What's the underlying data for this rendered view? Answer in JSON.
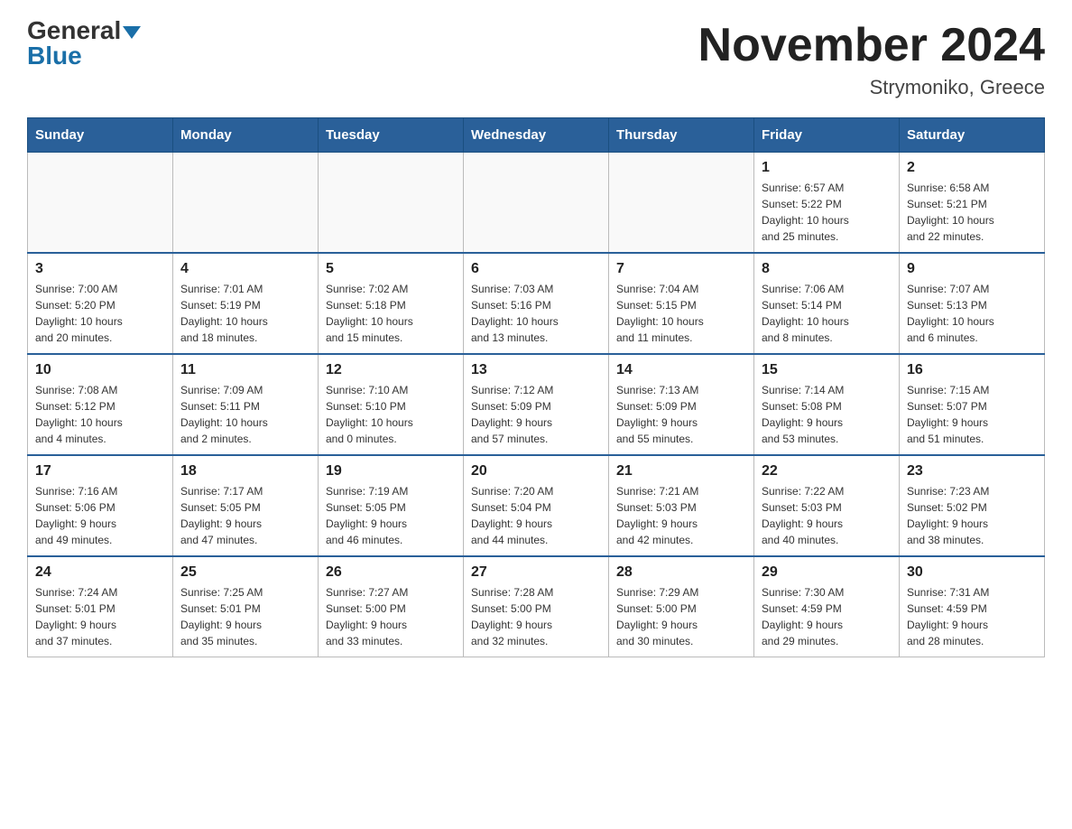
{
  "header": {
    "logo_general": "General",
    "logo_blue": "Blue",
    "title": "November 2024",
    "subtitle": "Strymoniko, Greece"
  },
  "weekdays": [
    "Sunday",
    "Monday",
    "Tuesday",
    "Wednesday",
    "Thursday",
    "Friday",
    "Saturday"
  ],
  "weeks": [
    [
      {
        "day": "",
        "info": ""
      },
      {
        "day": "",
        "info": ""
      },
      {
        "day": "",
        "info": ""
      },
      {
        "day": "",
        "info": ""
      },
      {
        "day": "",
        "info": ""
      },
      {
        "day": "1",
        "info": "Sunrise: 6:57 AM\nSunset: 5:22 PM\nDaylight: 10 hours\nand 25 minutes."
      },
      {
        "day": "2",
        "info": "Sunrise: 6:58 AM\nSunset: 5:21 PM\nDaylight: 10 hours\nand 22 minutes."
      }
    ],
    [
      {
        "day": "3",
        "info": "Sunrise: 7:00 AM\nSunset: 5:20 PM\nDaylight: 10 hours\nand 20 minutes."
      },
      {
        "day": "4",
        "info": "Sunrise: 7:01 AM\nSunset: 5:19 PM\nDaylight: 10 hours\nand 18 minutes."
      },
      {
        "day": "5",
        "info": "Sunrise: 7:02 AM\nSunset: 5:18 PM\nDaylight: 10 hours\nand 15 minutes."
      },
      {
        "day": "6",
        "info": "Sunrise: 7:03 AM\nSunset: 5:16 PM\nDaylight: 10 hours\nand 13 minutes."
      },
      {
        "day": "7",
        "info": "Sunrise: 7:04 AM\nSunset: 5:15 PM\nDaylight: 10 hours\nand 11 minutes."
      },
      {
        "day": "8",
        "info": "Sunrise: 7:06 AM\nSunset: 5:14 PM\nDaylight: 10 hours\nand 8 minutes."
      },
      {
        "day": "9",
        "info": "Sunrise: 7:07 AM\nSunset: 5:13 PM\nDaylight: 10 hours\nand 6 minutes."
      }
    ],
    [
      {
        "day": "10",
        "info": "Sunrise: 7:08 AM\nSunset: 5:12 PM\nDaylight: 10 hours\nand 4 minutes."
      },
      {
        "day": "11",
        "info": "Sunrise: 7:09 AM\nSunset: 5:11 PM\nDaylight: 10 hours\nand 2 minutes."
      },
      {
        "day": "12",
        "info": "Sunrise: 7:10 AM\nSunset: 5:10 PM\nDaylight: 10 hours\nand 0 minutes."
      },
      {
        "day": "13",
        "info": "Sunrise: 7:12 AM\nSunset: 5:09 PM\nDaylight: 9 hours\nand 57 minutes."
      },
      {
        "day": "14",
        "info": "Sunrise: 7:13 AM\nSunset: 5:09 PM\nDaylight: 9 hours\nand 55 minutes."
      },
      {
        "day": "15",
        "info": "Sunrise: 7:14 AM\nSunset: 5:08 PM\nDaylight: 9 hours\nand 53 minutes."
      },
      {
        "day": "16",
        "info": "Sunrise: 7:15 AM\nSunset: 5:07 PM\nDaylight: 9 hours\nand 51 minutes."
      }
    ],
    [
      {
        "day": "17",
        "info": "Sunrise: 7:16 AM\nSunset: 5:06 PM\nDaylight: 9 hours\nand 49 minutes."
      },
      {
        "day": "18",
        "info": "Sunrise: 7:17 AM\nSunset: 5:05 PM\nDaylight: 9 hours\nand 47 minutes."
      },
      {
        "day": "19",
        "info": "Sunrise: 7:19 AM\nSunset: 5:05 PM\nDaylight: 9 hours\nand 46 minutes."
      },
      {
        "day": "20",
        "info": "Sunrise: 7:20 AM\nSunset: 5:04 PM\nDaylight: 9 hours\nand 44 minutes."
      },
      {
        "day": "21",
        "info": "Sunrise: 7:21 AM\nSunset: 5:03 PM\nDaylight: 9 hours\nand 42 minutes."
      },
      {
        "day": "22",
        "info": "Sunrise: 7:22 AM\nSunset: 5:03 PM\nDaylight: 9 hours\nand 40 minutes."
      },
      {
        "day": "23",
        "info": "Sunrise: 7:23 AM\nSunset: 5:02 PM\nDaylight: 9 hours\nand 38 minutes."
      }
    ],
    [
      {
        "day": "24",
        "info": "Sunrise: 7:24 AM\nSunset: 5:01 PM\nDaylight: 9 hours\nand 37 minutes."
      },
      {
        "day": "25",
        "info": "Sunrise: 7:25 AM\nSunset: 5:01 PM\nDaylight: 9 hours\nand 35 minutes."
      },
      {
        "day": "26",
        "info": "Sunrise: 7:27 AM\nSunset: 5:00 PM\nDaylight: 9 hours\nand 33 minutes."
      },
      {
        "day": "27",
        "info": "Sunrise: 7:28 AM\nSunset: 5:00 PM\nDaylight: 9 hours\nand 32 minutes."
      },
      {
        "day": "28",
        "info": "Sunrise: 7:29 AM\nSunset: 5:00 PM\nDaylight: 9 hours\nand 30 minutes."
      },
      {
        "day": "29",
        "info": "Sunrise: 7:30 AM\nSunset: 4:59 PM\nDaylight: 9 hours\nand 29 minutes."
      },
      {
        "day": "30",
        "info": "Sunrise: 7:31 AM\nSunset: 4:59 PM\nDaylight: 9 hours\nand 28 minutes."
      }
    ]
  ]
}
